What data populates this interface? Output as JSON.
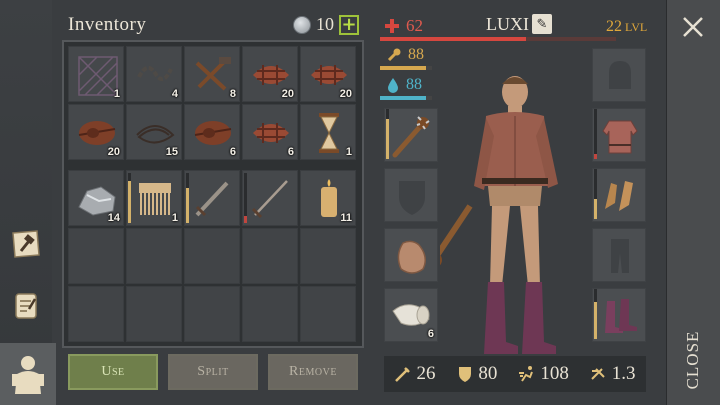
{
  "inventory": {
    "title": "Inventory",
    "coins": "10",
    "buttons": {
      "use": "Use",
      "split": "Split",
      "remove": "Remove"
    },
    "items": [
      {
        "name": "grid-frame",
        "count": "1"
      },
      {
        "name": "chain",
        "count": "4"
      },
      {
        "name": "tools",
        "count": "8"
      },
      {
        "name": "rope-bundle",
        "count": "20"
      },
      {
        "name": "rope-bundle",
        "count": "20"
      },
      {
        "name": "leather-roll",
        "count": "20"
      },
      {
        "name": "thread-coil",
        "count": "15"
      },
      {
        "name": "leather-roll",
        "count": "6"
      },
      {
        "name": "rope-bundle",
        "count": "6"
      },
      {
        "name": "hourglass",
        "count": "1"
      },
      {
        "name": "stone-ore",
        "count": "14"
      },
      {
        "name": "comb",
        "count": "1"
      },
      {
        "name": "sword",
        "count": ""
      },
      {
        "name": "rapier",
        "count": ""
      },
      {
        "name": "candle",
        "count": "11"
      }
    ]
  },
  "character": {
    "name": "LUXI",
    "level": "22",
    "level_label": "LVL",
    "health": "62",
    "hunger": "88",
    "thirst": "88",
    "health_fraction": 0.62,
    "hunger_fraction": 0.88,
    "thirst_fraction": 0.88,
    "equipment_count": "6",
    "stats": {
      "attack": "26",
      "defense": "80",
      "speed": "108",
      "weight": "1.3"
    }
  },
  "close_label": "CLOSE",
  "colors": {
    "health": "#d5473f",
    "hunger": "#d6a84f",
    "thirst": "#4fb3c8",
    "level": "#e0a83a",
    "accent_green": "#9ec23a"
  },
  "icons": [
    "hammer-note-icon",
    "scroll-icon",
    "character-icon",
    "coin-icon",
    "plus-icon",
    "edit-icon",
    "close-icon",
    "attack-icon",
    "shield-icon",
    "speed-icon",
    "weight-icon"
  ]
}
